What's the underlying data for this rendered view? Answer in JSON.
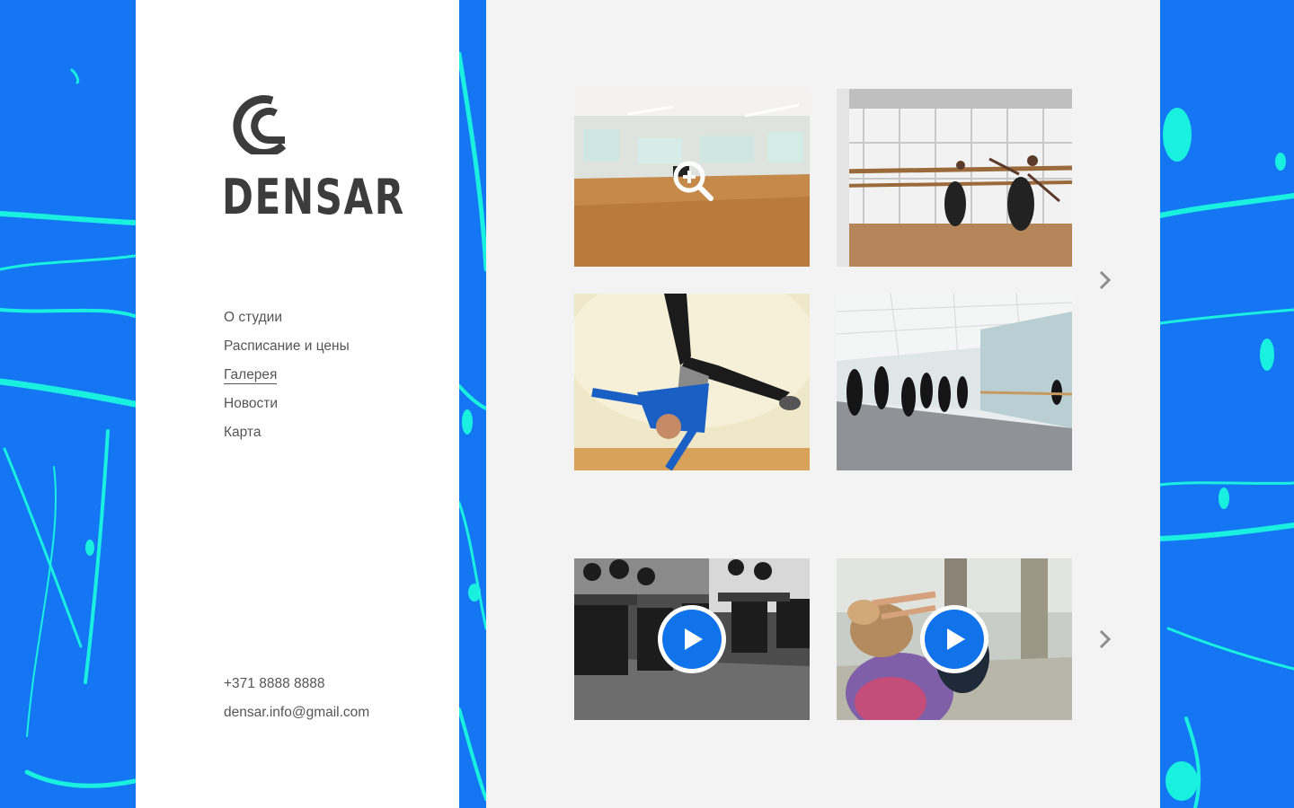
{
  "brand": {
    "name": "DENSAR",
    "logo_icon": "c-logo-icon"
  },
  "nav": {
    "items": [
      {
        "label": "О студии",
        "active": false
      },
      {
        "label": "Расписание и цены",
        "active": false
      },
      {
        "label": "Галерея",
        "active": true
      },
      {
        "label": "Новости",
        "active": false
      },
      {
        "label": "Карта",
        "active": false
      }
    ]
  },
  "contacts": {
    "phone": "+371 8888 8888",
    "email": "densar.info@gmail.com"
  },
  "gallery": {
    "photos": [
      {
        "name": "empty-dance-hall",
        "overlay_icon": "zoom-in-icon"
      },
      {
        "name": "dancer-at-barre"
      },
      {
        "name": "breakdancer-handstand"
      },
      {
        "name": "dance-class-group"
      }
    ],
    "videos": [
      {
        "name": "audience-video",
        "overlay_icon": "play-icon"
      },
      {
        "name": "dancer-outdoor-video",
        "overlay_icon": "play-icon"
      }
    ],
    "next_icon": "chevron-right-icon"
  },
  "colors": {
    "background_blue": "#1476f2",
    "splash_cyan": "#19f0e0",
    "sidebar": "#ffffff",
    "main": "#f3f3f3",
    "text": "#555555",
    "logo": "#3c3c3c",
    "play_accent": "#1073ea"
  }
}
